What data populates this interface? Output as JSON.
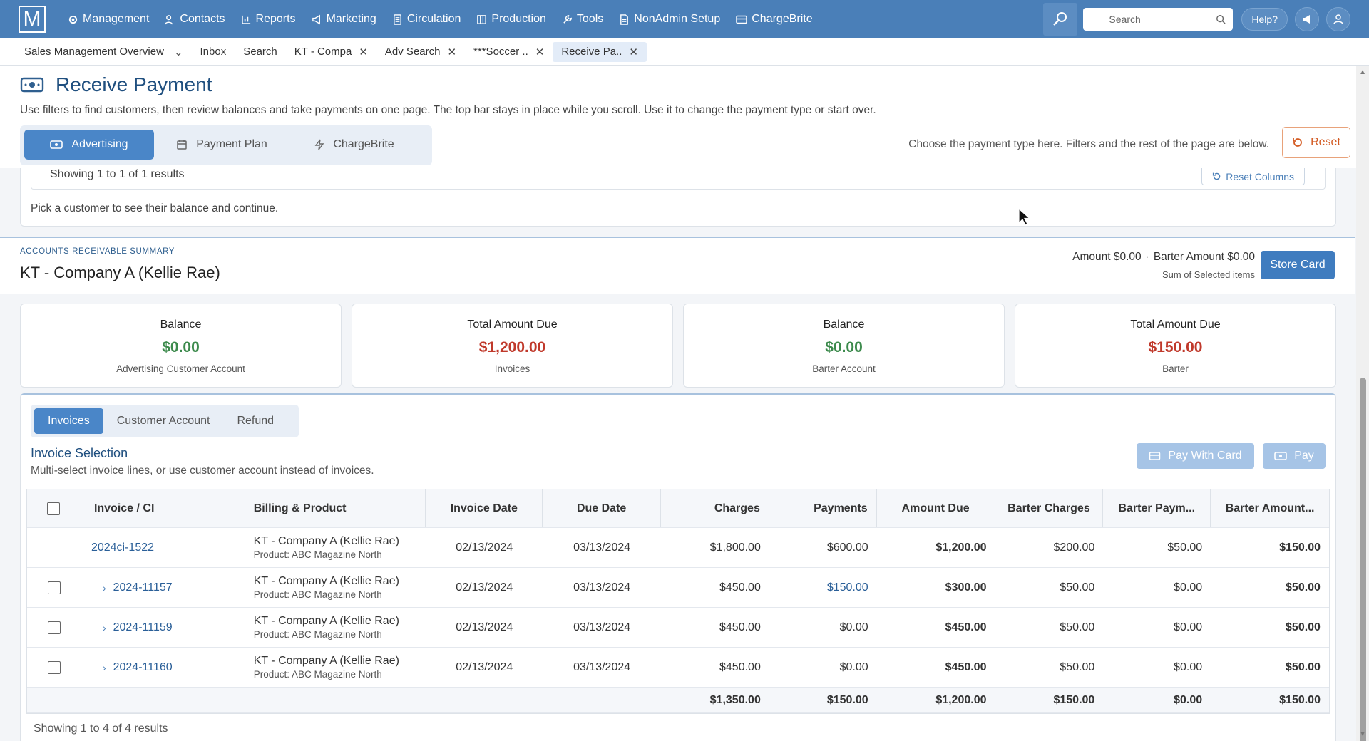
{
  "nav": {
    "logo": "M",
    "items": [
      {
        "label": "Management",
        "icon": "gear-icon"
      },
      {
        "label": "Contacts",
        "icon": "contacts-icon"
      },
      {
        "label": "Reports",
        "icon": "chart-icon"
      },
      {
        "label": "Marketing",
        "icon": "megaphone-icon"
      },
      {
        "label": "Circulation",
        "icon": "document-icon"
      },
      {
        "label": "Production",
        "icon": "building-icon"
      },
      {
        "label": "Tools",
        "icon": "wrench-icon"
      },
      {
        "label": "NonAdmin Setup",
        "icon": "file-icon"
      },
      {
        "label": "ChargeBrite",
        "icon": "card-icon"
      }
    ],
    "search_placeholder": "Search",
    "help_label": "Help?"
  },
  "tabs": [
    {
      "label": "Sales Management Overview",
      "closable": false,
      "dropdown": true
    },
    {
      "label": "Inbox",
      "closable": false
    },
    {
      "label": "Search",
      "closable": false
    },
    {
      "label": "KT - Compa",
      "closable": true
    },
    {
      "label": "Adv Search",
      "closable": true
    },
    {
      "label": "***Soccer ..",
      "closable": true
    },
    {
      "label": "Receive Pa..",
      "closable": true,
      "active": true
    }
  ],
  "header": {
    "title": "Receive Payment",
    "description": "Use filters to find customers, then review balances and take payments on one page. The top bar stays in place while you scroll. Use it to change the payment type or start over.",
    "payment_types": [
      "Advertising",
      "Payment Plan",
      "ChargeBrite"
    ],
    "hint": "Choose the payment type here. Filters and the rest of the page are below.",
    "reset_label": "Reset"
  },
  "results": {
    "showing": "Showing 1 to 1 of 1 results",
    "reset_columns": "Reset Columns",
    "pick_text": "Pick a customer to see their balance and continue."
  },
  "ar": {
    "label": "ACCOUNTS RECEIVABLE SUMMARY",
    "customer": "KT - Company A (Kellie Rae)",
    "amount": "Amount $0.00",
    "barter_amount": "Barter Amount $0.00",
    "sum_label": "Sum of Selected items",
    "store_card": "Store Card"
  },
  "cards": [
    {
      "title": "Balance",
      "value": "$0.00",
      "sub": "Advertising Customer Account",
      "color": "#3c8a4c"
    },
    {
      "title": "Total Amount Due",
      "value": "$1,200.00",
      "sub": "Invoices",
      "color": "#c0392b"
    },
    {
      "title": "Balance",
      "value": "$0.00",
      "sub": "Barter Account",
      "color": "#3c8a4c"
    },
    {
      "title": "Total Amount Due",
      "value": "$150.00",
      "sub": "Barter",
      "color": "#c0392b"
    }
  ],
  "invoice": {
    "subtabs": [
      "Invoices",
      "Customer Account",
      "Refund"
    ],
    "title": "Invoice Selection",
    "subtitle": "Multi-select invoice lines, or use customer account instead of invoices.",
    "pay_with_card": "Pay With Card",
    "pay": "Pay",
    "columns": [
      "Invoice / CI",
      "Billing & Product",
      "Invoice Date",
      "Due Date",
      "Charges",
      "Payments",
      "Amount Due",
      "Barter Charges",
      "Barter Paym...",
      "Barter Amount..."
    ],
    "rows": [
      {
        "invoice": "2024ci-1522",
        "billing": "KT - Company A (Kellie Rae)",
        "product": "Product: ABC Magazine North",
        "invoice_date": "02/13/2024",
        "due_date": "03/13/2024",
        "charges": "$1,800.00",
        "payments": "$600.00",
        "amount_due": "$1,200.00",
        "barter_charges": "$200.00",
        "barter_payments": "$50.00",
        "barter_amount": "$150.00"
      },
      {
        "invoice": "2024-11157",
        "billing": "KT - Company A (Kellie Rae)",
        "product": "Product: ABC Magazine North",
        "invoice_date": "02/13/2024",
        "due_date": "03/13/2024",
        "charges": "$450.00",
        "payments": "$150.00",
        "amount_due": "$300.00",
        "barter_charges": "$50.00",
        "barter_payments": "$0.00",
        "barter_amount": "$50.00"
      },
      {
        "invoice": "2024-11159",
        "billing": "KT - Company A (Kellie Rae)",
        "product": "Product: ABC Magazine North",
        "invoice_date": "02/13/2024",
        "due_date": "03/13/2024",
        "charges": "$450.00",
        "payments": "$0.00",
        "amount_due": "$450.00",
        "barter_charges": "$50.00",
        "barter_payments": "$0.00",
        "barter_amount": "$50.00"
      },
      {
        "invoice": "2024-11160",
        "billing": "KT - Company A (Kellie Rae)",
        "product": "Product: ABC Magazine North",
        "invoice_date": "02/13/2024",
        "due_date": "03/13/2024",
        "charges": "$450.00",
        "payments": "$0.00",
        "amount_due": "$450.00",
        "barter_charges": "$50.00",
        "barter_payments": "$0.00",
        "barter_amount": "$50.00"
      }
    ],
    "totals": {
      "charges": "$1,350.00",
      "payments": "$150.00",
      "amount_due": "$1,200.00",
      "barter_charges": "$150.00",
      "barter_payments": "$0.00",
      "barter_amount": "$150.00"
    },
    "showing": "Showing 1 to 4 of 4 results"
  }
}
